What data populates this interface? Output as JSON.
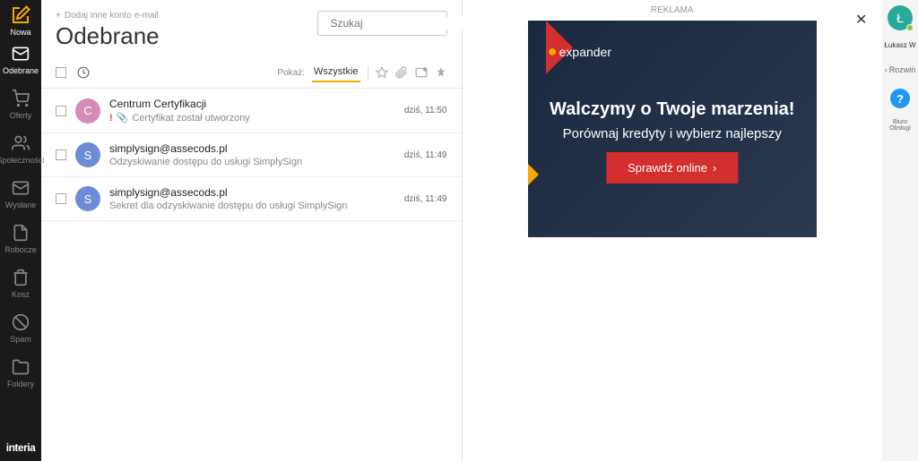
{
  "sidebar": {
    "compose_label": "Nowa",
    "items": [
      {
        "label": "Odebrane",
        "active": true
      },
      {
        "label": "Oferty",
        "active": false
      },
      {
        "label": "Społeczności",
        "active": false
      },
      {
        "label": "Wysłane",
        "active": false
      },
      {
        "label": "Robocze",
        "active": false
      },
      {
        "label": "Kosz",
        "active": false
      },
      {
        "label": "Spam",
        "active": false
      },
      {
        "label": "Foldery",
        "active": false
      }
    ],
    "footer": "interia"
  },
  "header": {
    "add_account": "Dodaj inne konto e-mail",
    "title": "Odebrane",
    "search_placeholder": "Szukaj"
  },
  "filters": {
    "show_label": "Pokaż:",
    "all_tab": "Wszystkie"
  },
  "emails": [
    {
      "avatar": "C",
      "avatar_class": "avatar-c",
      "sender": "Centrum Certyfikacji",
      "subject": "Certyfikat został utworzony",
      "time": "dziś, 11:50",
      "priority": true,
      "attachment": true
    },
    {
      "avatar": "S",
      "avatar_class": "avatar-s",
      "sender": "simplysign@assecods.pl",
      "subject": "Odzyskiwanie dostępu do usługi SimplySign",
      "time": "dziś, 11:49",
      "priority": false,
      "attachment": false
    },
    {
      "avatar": "S",
      "avatar_class": "avatar-s",
      "sender": "simplysign@assecods.pl",
      "subject": "Sekret dla odzyskiwanie dostępu do usługi SimplySign",
      "time": "dziś, 11:49",
      "priority": false,
      "attachment": false
    }
  ],
  "ad": {
    "label": "REKLAMA",
    "brand": "expander",
    "title": "Walczymy o Twoje marzenia!",
    "subtitle": "Porównaj kredyty i wybierz najlepszy",
    "button": "Sprawdź online"
  },
  "right": {
    "user_initial": "Ł",
    "user_name": "Łukasz W",
    "expand": "Rozwiń",
    "help_label": "Biuro Obsługi"
  }
}
